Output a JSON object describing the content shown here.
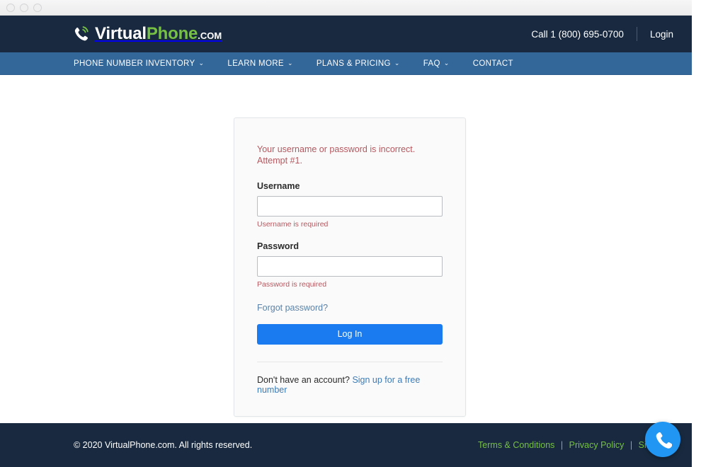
{
  "window": {
    "traffic_lights": [
      "close",
      "minimize",
      "maximize"
    ]
  },
  "header": {
    "logo": {
      "icon": "phone-signal-icon",
      "part1": "Virtual",
      "part2": "Phone",
      "part3": ".COM",
      "color_part1": "#ffffff",
      "color_part2": "#76c043"
    },
    "call_label": "Call 1 (800) 695-0700",
    "login_label": "Login",
    "background": "#192a40"
  },
  "nav": {
    "background": "#336699",
    "items": [
      {
        "label": "PHONE NUMBER INVENTORY",
        "has_caret": true,
        "caret": "⌄"
      },
      {
        "label": "LEARN MORE",
        "has_caret": true,
        "caret": "⌄"
      },
      {
        "label": "PLANS & PRICING",
        "has_caret": true,
        "caret": "⌄"
      },
      {
        "label": "FAQ",
        "has_caret": true,
        "caret": "⌄"
      },
      {
        "label": "CONTACT",
        "has_caret": false,
        "caret": ""
      }
    ]
  },
  "login_card": {
    "form_error": "Your username or password is incorrect. Attempt #1.",
    "error_color": "#b5585f",
    "username": {
      "label": "Username",
      "value": "",
      "placeholder": "",
      "error": "Username is required"
    },
    "password": {
      "label": "Password",
      "value": "",
      "placeholder": "",
      "error": "Password is required"
    },
    "forgot_password_label": "Forgot password?",
    "submit_label": "Log In",
    "submit_color": "#1a7af0",
    "signup_prompt": "Don't have an account?",
    "signup_link_label": "Sign up for a free number"
  },
  "footer": {
    "copyright": "© 2020 VirtualPhone.com. All rights reserved.",
    "link_color": "#76c043",
    "links": [
      {
        "label": "Terms & Conditions"
      },
      {
        "label": "Privacy Policy"
      },
      {
        "label": "Site Map"
      }
    ],
    "separator": "|"
  },
  "call_fab": {
    "icon": "phone-handset-icon",
    "color": "#2196f3"
  }
}
